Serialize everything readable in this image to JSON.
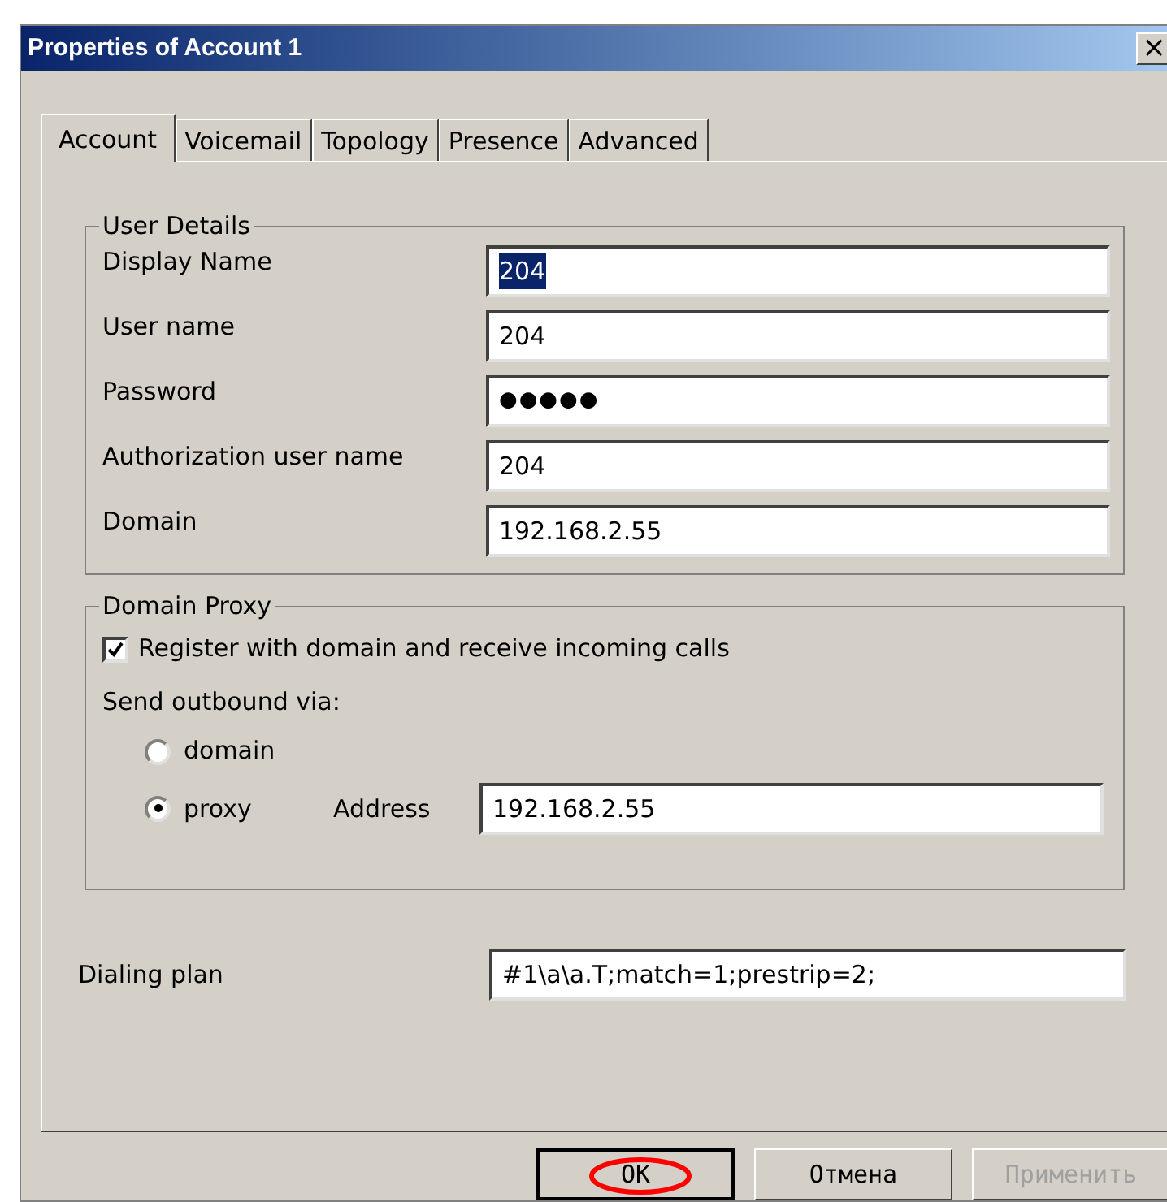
{
  "window": {
    "title": "Properties of Account 1",
    "close": "×"
  },
  "tabs": [
    {
      "label": "Account",
      "selected": true
    },
    {
      "label": "Voicemail",
      "selected": false
    },
    {
      "label": "Topology",
      "selected": false
    },
    {
      "label": "Presence",
      "selected": false
    },
    {
      "label": "Advanced",
      "selected": false
    }
  ],
  "user_details": {
    "title": "User Details",
    "fields": [
      {
        "label": "Display Name",
        "value": "204",
        "kind": "text",
        "selected": true
      },
      {
        "label": "User name",
        "value": "204",
        "kind": "text",
        "selected": false
      },
      {
        "label": "Password",
        "value": "●●●●●",
        "kind": "password",
        "selected": false
      },
      {
        "label": "Authorization user name",
        "value": "204",
        "kind": "text",
        "selected": false
      },
      {
        "label": "Domain",
        "value": "192.168.2.55",
        "kind": "text",
        "selected": false
      }
    ]
  },
  "domain_proxy": {
    "title": "Domain Proxy",
    "register": {
      "label": "Register with domain and receive incoming calls",
      "checked": true
    },
    "send_via_label": "Send outbound via:",
    "options": [
      {
        "label": "domain",
        "selected": false
      },
      {
        "label": "proxy",
        "selected": true
      }
    ],
    "address_label": "Address",
    "address_value": "192.168.2.55"
  },
  "dialing_plan": {
    "label": "Dialing plan",
    "value": "#1\\a\\a.T;match=1;prestrip=2;"
  },
  "buttons": [
    {
      "label": "OK",
      "disabled": false,
      "default": true,
      "highlighted": true
    },
    {
      "label": "Отмена",
      "disabled": false,
      "default": false,
      "highlighted": false
    },
    {
      "label": "Применить",
      "disabled": true,
      "default": false,
      "highlighted": false
    }
  ]
}
